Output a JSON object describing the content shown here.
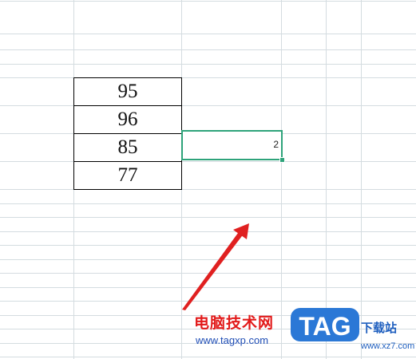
{
  "spreadsheet": {
    "values": [
      "95",
      "96",
      "85",
      "77"
    ],
    "active_cell_value": "2",
    "active_border_color": "#2ea37a",
    "gridline_color": "#d4dce0"
  },
  "annotation": {
    "arrow_color": "#e02020",
    "arrow_icon": "red-arrow-icon"
  },
  "watermark": {
    "site_name": "电脑技术网",
    "site_url": "www.tagxp.com",
    "logo_text": "TAG",
    "side_text": "下载站",
    "side_url": "www.xz7.com"
  }
}
